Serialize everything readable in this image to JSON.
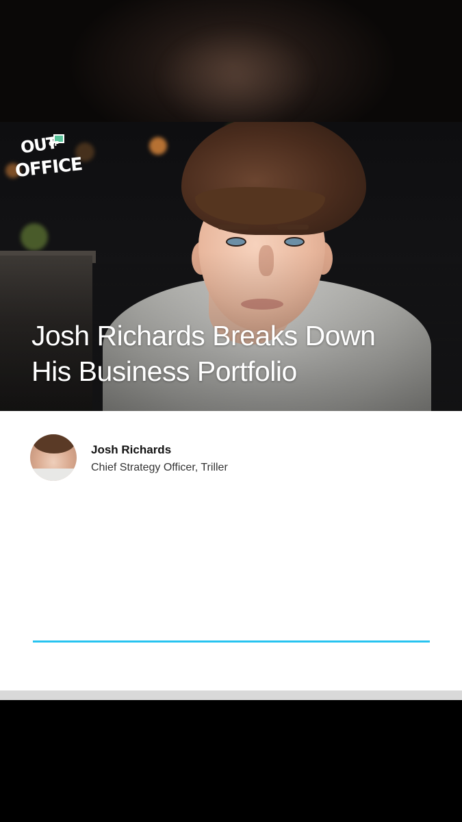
{
  "logo": {
    "line1": "OUT",
    "line2": "OF",
    "line3": "OFFICE",
    "icon": "envelope-icon"
  },
  "headline": {
    "line1": "Josh Richards Breaks Down",
    "line2": "His Business Portfolio"
  },
  "author": {
    "name": "Josh Richards",
    "role": "Chief Strategy Officer, Triller"
  },
  "progress": {
    "value": 1.0
  },
  "colors": {
    "accent": "#27c3f0",
    "card_background": "#ffffff",
    "page_background": "#000000"
  }
}
